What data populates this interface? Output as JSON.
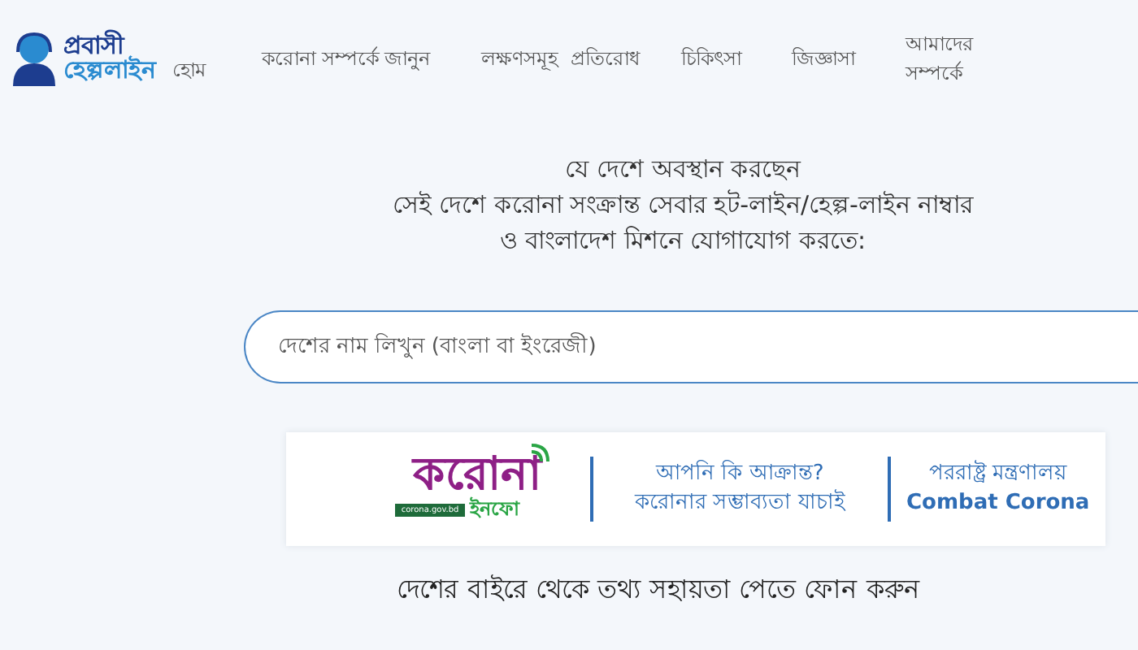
{
  "logo": {
    "line_1": "প্রবাসী",
    "line_2": "হেল্পলাইন"
  },
  "nav": [
    {
      "label": "হোম"
    },
    {
      "label": "করোনা সম্পর্কে জানুন"
    },
    {
      "label": "লক্ষণসমূহ"
    },
    {
      "label": "প্রতিরোধ"
    },
    {
      "label": "চিকিৎসা"
    },
    {
      "label": "জিজ্ঞাসা"
    },
    {
      "label": "আমাদের সম্পর্কে"
    }
  ],
  "intro": [
    "যে দেশে অবস্থান করছেন",
    "সেই দেশে করোনা সংক্রান্ত সেবার হট-লাইন/হেল্প-লাইন নাম্বার",
    "ও বাংলাদেশ মিশনে যোগাযোগ করতে:"
  ],
  "search": {
    "placeholder": "দেশের নাম লিখুন (বাংলা বা ইংরেজী)"
  },
  "banner": {
    "logo_main": "করোনা",
    "logo_sub": "ইনফো",
    "logo_url": "corona.gov.bd",
    "links": [
      {
        "line_1": "আপনি কি আক্রান্ত?",
        "line_2": "করোনার সম্ভাব্যতা যাচাই"
      },
      {
        "line_1": "পররাষ্ট্র মন্ত্রণালয়",
        "line_2": "Combat Corona"
      }
    ]
  },
  "call_heading": "দেশের বাইরে থেকে তথ্য সহায়তা পেতে ফোন করুন"
}
